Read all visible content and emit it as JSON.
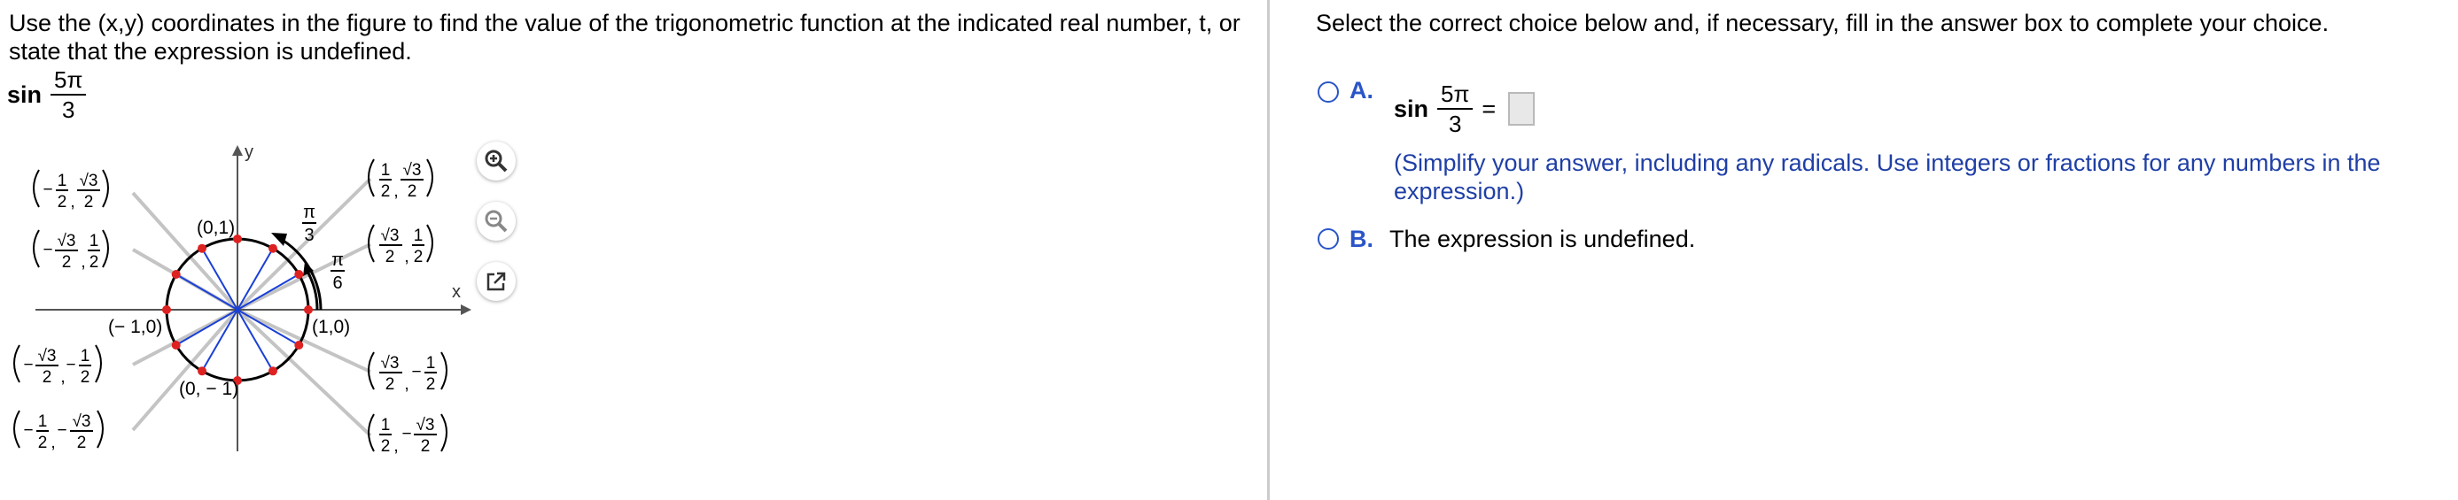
{
  "question": {
    "text": "Use the (x,y) coordinates in the figure to find the value of the trigonometric function at the indicated real number, t, or state that the expression is undefined.",
    "func_name": "sin",
    "t_num": "5π",
    "t_den": "3"
  },
  "figure": {
    "axis_x": "x",
    "axis_y": "y",
    "labels": {
      "top": "(0,1)",
      "right": "(1,0)",
      "left": "(− 1,0)",
      "bottom": "(0, − 1)"
    },
    "angles": {
      "pi": "π",
      "three": "3",
      "six": "6"
    },
    "pair_parts": {
      "one": "1",
      "two": "2",
      "root3": "√3",
      "minus": "−",
      "comma": ","
    }
  },
  "tools": {
    "zoom_in": "zoom-in-icon",
    "zoom_out": "zoom-out-icon",
    "popout": "popout-icon"
  },
  "answer": {
    "instruction": "Select the correct choice below and, if necessary, fill in the answer box to complete your choice.",
    "choice_a_letter": "A.",
    "a_func": "sin",
    "a_num": "5π",
    "a_den": "3",
    "equals": "=",
    "hint": "(Simplify your answer, including any radicals. Use integers or fractions for any numbers in the expression.)",
    "choice_b_letter": "B.",
    "choice_b_text": "The expression is undefined."
  },
  "colors": {
    "accent_blue": "#2a55c8",
    "hint_blue": "#1f3fa6",
    "ray_blue": "#1a3fd6",
    "point_red": "#dd2222",
    "guide_gray": "#c4c4c4"
  }
}
